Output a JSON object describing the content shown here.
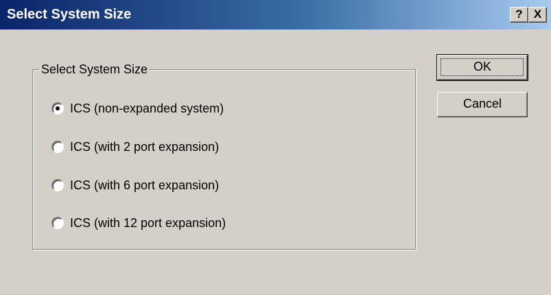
{
  "window": {
    "title": "Select System Size",
    "help_label": "?",
    "close_label": "X"
  },
  "group": {
    "label": "Select System Size",
    "options": [
      {
        "label": "ICS (non-expanded system)",
        "selected": true
      },
      {
        "label": "ICS (with 2 port expansion)",
        "selected": false
      },
      {
        "label": "ICS (with 6 port expansion)",
        "selected": false
      },
      {
        "label": "ICS (with 12 port expansion)",
        "selected": false
      }
    ]
  },
  "buttons": {
    "ok_label": "OK",
    "cancel_label": "Cancel"
  },
  "colors": {
    "face": "#d4d0c8",
    "title_start": "#0a246a",
    "title_end": "#a6caf0"
  }
}
